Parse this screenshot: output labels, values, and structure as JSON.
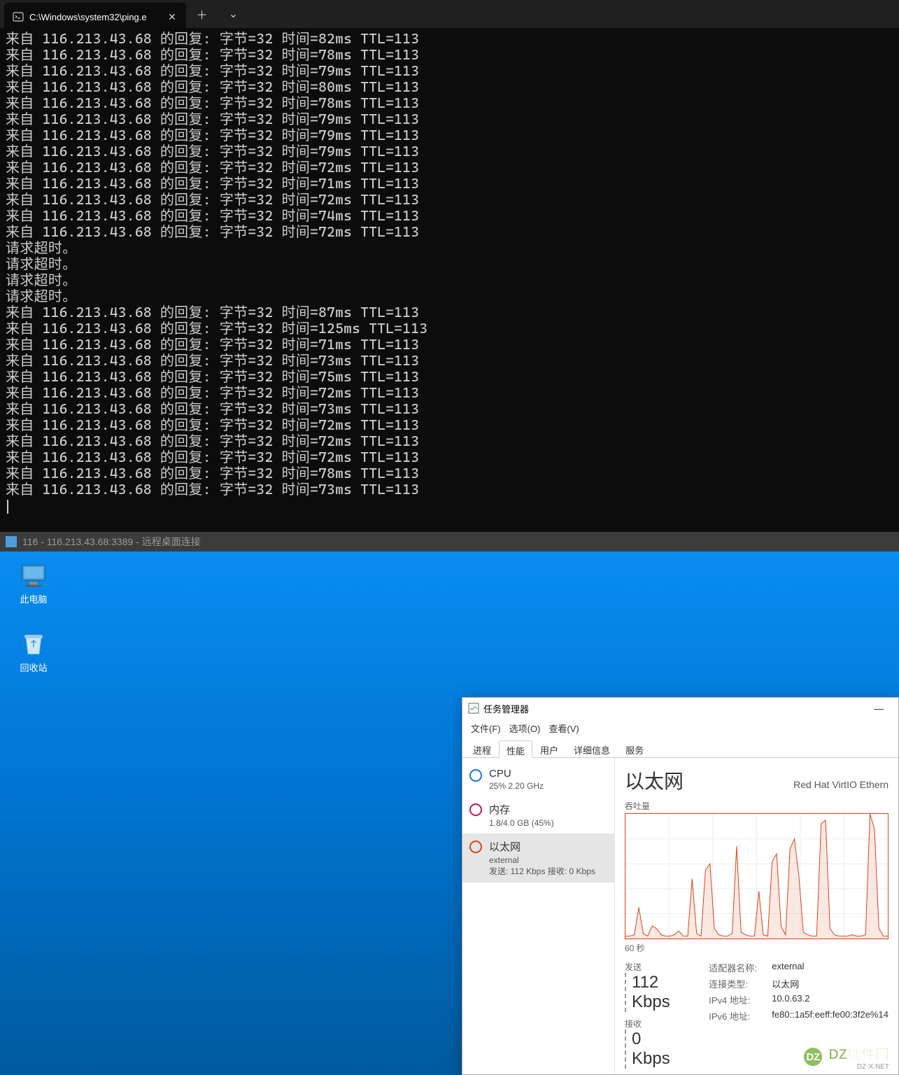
{
  "terminal": {
    "tab_title": "C:\\Windows\\system32\\ping.e",
    "lines": [
      "来自 116.213.43.68 的回复: 字节=32 时间=82ms TTL=113",
      "来自 116.213.43.68 的回复: 字节=32 时间=78ms TTL=113",
      "来自 116.213.43.68 的回复: 字节=32 时间=79ms TTL=113",
      "来自 116.213.43.68 的回复: 字节=32 时间=80ms TTL=113",
      "来自 116.213.43.68 的回复: 字节=32 时间=78ms TTL=113",
      "来自 116.213.43.68 的回复: 字节=32 时间=79ms TTL=113",
      "来自 116.213.43.68 的回复: 字节=32 时间=79ms TTL=113",
      "来自 116.213.43.68 的回复: 字节=32 时间=79ms TTL=113",
      "来自 116.213.43.68 的回复: 字节=32 时间=72ms TTL=113",
      "来自 116.213.43.68 的回复: 字节=32 时间=71ms TTL=113",
      "来自 116.213.43.68 的回复: 字节=32 时间=72ms TTL=113",
      "来自 116.213.43.68 的回复: 字节=32 时间=74ms TTL=113",
      "来自 116.213.43.68 的回复: 字节=32 时间=72ms TTL=113",
      "请求超时。",
      "请求超时。",
      "请求超时。",
      "请求超时。",
      "来自 116.213.43.68 的回复: 字节=32 时间=87ms TTL=113",
      "来自 116.213.43.68 的回复: 字节=32 时间=125ms TTL=113",
      "来自 116.213.43.68 的回复: 字节=32 时间=71ms TTL=113",
      "来自 116.213.43.68 的回复: 字节=32 时间=73ms TTL=113",
      "来自 116.213.43.68 的回复: 字节=32 时间=75ms TTL=113",
      "来自 116.213.43.68 的回复: 字节=32 时间=72ms TTL=113",
      "来自 116.213.43.68 的回复: 字节=32 时间=73ms TTL=113",
      "来自 116.213.43.68 的回复: 字节=32 时间=72ms TTL=113",
      "来自 116.213.43.68 的回复: 字节=32 时间=72ms TTL=113",
      "来自 116.213.43.68 的回复: 字节=32 时间=72ms TTL=113",
      "来自 116.213.43.68 的回复: 字节=32 时间=78ms TTL=113",
      "来自 116.213.43.68 的回复: 字节=32 时间=73ms TTL=113"
    ]
  },
  "rdp": {
    "title": "116 - 116.213.43.68:3389 - 远程桌面连接"
  },
  "desktop": {
    "icons": [
      {
        "label": "此电脑"
      },
      {
        "label": "回收站"
      }
    ]
  },
  "taskmgr": {
    "title": "任务管理器",
    "menu": [
      "文件(F)",
      "选项(O)",
      "查看(V)"
    ],
    "tabs": [
      "进程",
      "性能",
      "用户",
      "详细信息",
      "服务"
    ],
    "active_tab": 1,
    "side": [
      {
        "title": "CPU",
        "sub": "25% 2.20 GHz"
      },
      {
        "title": "内存",
        "sub": "1.8/4.0 GB (45%)"
      },
      {
        "title": "以太网",
        "sub": "external",
        "sub2": "发送: 112 Kbps 接收: 0 Kbps"
      }
    ],
    "main": {
      "title": "以太网",
      "adapter": "Red Hat VirtIO Ethern",
      "section": "吞吐量",
      "timespan": "60 秒",
      "send_label": "发送",
      "send_value": "112 Kbps",
      "recv_label": "接收",
      "recv_value": "0 Kbps",
      "info": [
        {
          "k": "适配器名称:",
          "v": "external"
        },
        {
          "k": "连接类型:",
          "v": "以太网"
        },
        {
          "k": "IPv4 地址:",
          "v": "10.0.63.2"
        },
        {
          "k": "IPv6 地址:",
          "v": "fe80::1a5f:eeff:fe00:3f2e%14"
        }
      ]
    }
  },
  "watermark": {
    "brand": "DZ插件网",
    "sub": "DZ-X.NET"
  },
  "chart_data": {
    "type": "line",
    "title": "吞吐量",
    "xlabel": "60 秒",
    "ylabel": "",
    "series": [
      {
        "name": "发送",
        "color": "#d84315",
        "values": [
          2,
          2,
          3,
          25,
          4,
          2,
          10,
          8,
          3,
          2,
          2,
          3,
          6,
          2,
          2,
          48,
          4,
          2,
          55,
          60,
          8,
          3,
          2,
          2,
          4,
          74,
          5,
          3,
          2,
          2,
          38,
          3,
          2,
          62,
          68,
          10,
          3,
          72,
          80,
          50,
          5,
          3,
          2,
          2,
          92,
          95,
          8,
          3,
          2,
          2,
          2,
          3,
          2,
          2,
          3,
          100,
          88,
          8,
          2,
          2
        ]
      },
      {
        "name": "接收",
        "color": "#d84315",
        "values": [
          0,
          0,
          0,
          0,
          0,
          0,
          0,
          0,
          0,
          0,
          0,
          0,
          0,
          0,
          0,
          0,
          0,
          0,
          0,
          0,
          0,
          0,
          0,
          0,
          0,
          0,
          0,
          0,
          0,
          0,
          0,
          0,
          0,
          0,
          0,
          0,
          0,
          0,
          0,
          0,
          0,
          0,
          0,
          0,
          0,
          0,
          0,
          0,
          0,
          0,
          0,
          0,
          0,
          0,
          0,
          0,
          0,
          0,
          0,
          0
        ]
      }
    ],
    "ylim": [
      0,
      100
    ]
  }
}
